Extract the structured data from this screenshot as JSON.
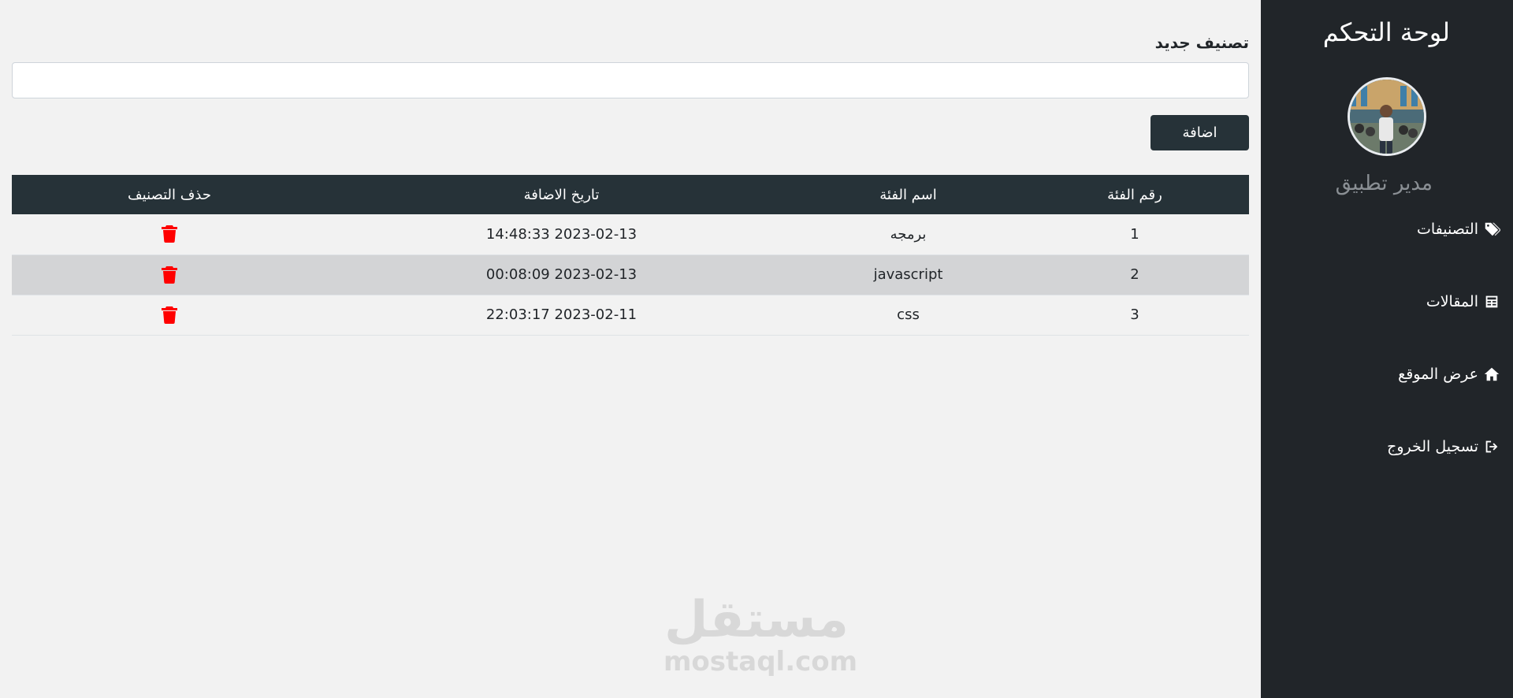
{
  "sidebar": {
    "title": "لوحة التحكم",
    "user_name": "مدير تطبيق",
    "items": [
      {
        "label": "التصنيفات",
        "icon": "tags-icon"
      },
      {
        "label": "المقالات",
        "icon": "newspaper-icon"
      },
      {
        "label": "عرض الموقع",
        "icon": "home-icon"
      },
      {
        "label": "تسجيل الخروج",
        "icon": "logout-icon"
      }
    ]
  },
  "form": {
    "label": "تصنيف جديد",
    "input_value": "",
    "add_button": "اضافة"
  },
  "table": {
    "headers": [
      "رقم الفئة",
      "اسم الفئة",
      "تاريخ الاضافة",
      "حذف التصنيف"
    ],
    "rows": [
      {
        "id": "1",
        "name": "برمجه",
        "date": "2023-02-13 14:48:33"
      },
      {
        "id": "2",
        "name": "javascript",
        "date": "2023-02-13 00:08:09"
      },
      {
        "id": "3",
        "name": "css",
        "date": "2023-02-11 22:03:17"
      }
    ]
  },
  "watermark": {
    "logo_text": "مستقل",
    "domain": "mostaql.com"
  },
  "colors": {
    "sidebar_bg": "#212529",
    "header_bg": "#263238",
    "page_bg": "#f2f2f2",
    "delete_icon": "#ff0000",
    "stripe_row": "#d3d4d6"
  }
}
